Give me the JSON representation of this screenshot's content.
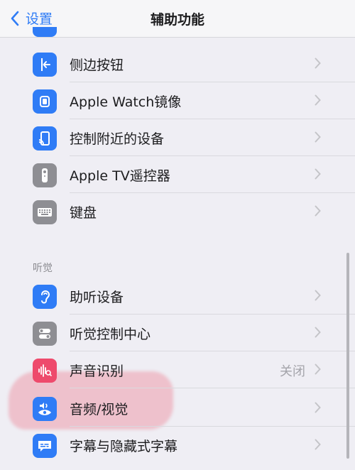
{
  "nav": {
    "back_label": "设置",
    "title": "辅助功能"
  },
  "section_hearing": "听觉",
  "rows": [
    {
      "label": "侧边按钮",
      "value": ""
    },
    {
      "label": "Apple Watch镜像",
      "value": ""
    },
    {
      "label": "控制附近的设备",
      "value": ""
    },
    {
      "label": "Apple TV遥控器",
      "value": ""
    },
    {
      "label": "键盘",
      "value": ""
    },
    {
      "label": "助听设备",
      "value": ""
    },
    {
      "label": "听觉控制中心",
      "value": ""
    },
    {
      "label": "声音识别",
      "value": "关闭"
    },
    {
      "label": "音频/视觉",
      "value": ""
    },
    {
      "label": "字幕与隐藏式字幕",
      "value": ""
    }
  ],
  "colors": {
    "accent": "#2f7cf6",
    "icon_blue": "#2f7cf6",
    "icon_gray": "#8e8e93",
    "icon_pink": "#ee4a6c",
    "highlight": "#ec788c"
  }
}
